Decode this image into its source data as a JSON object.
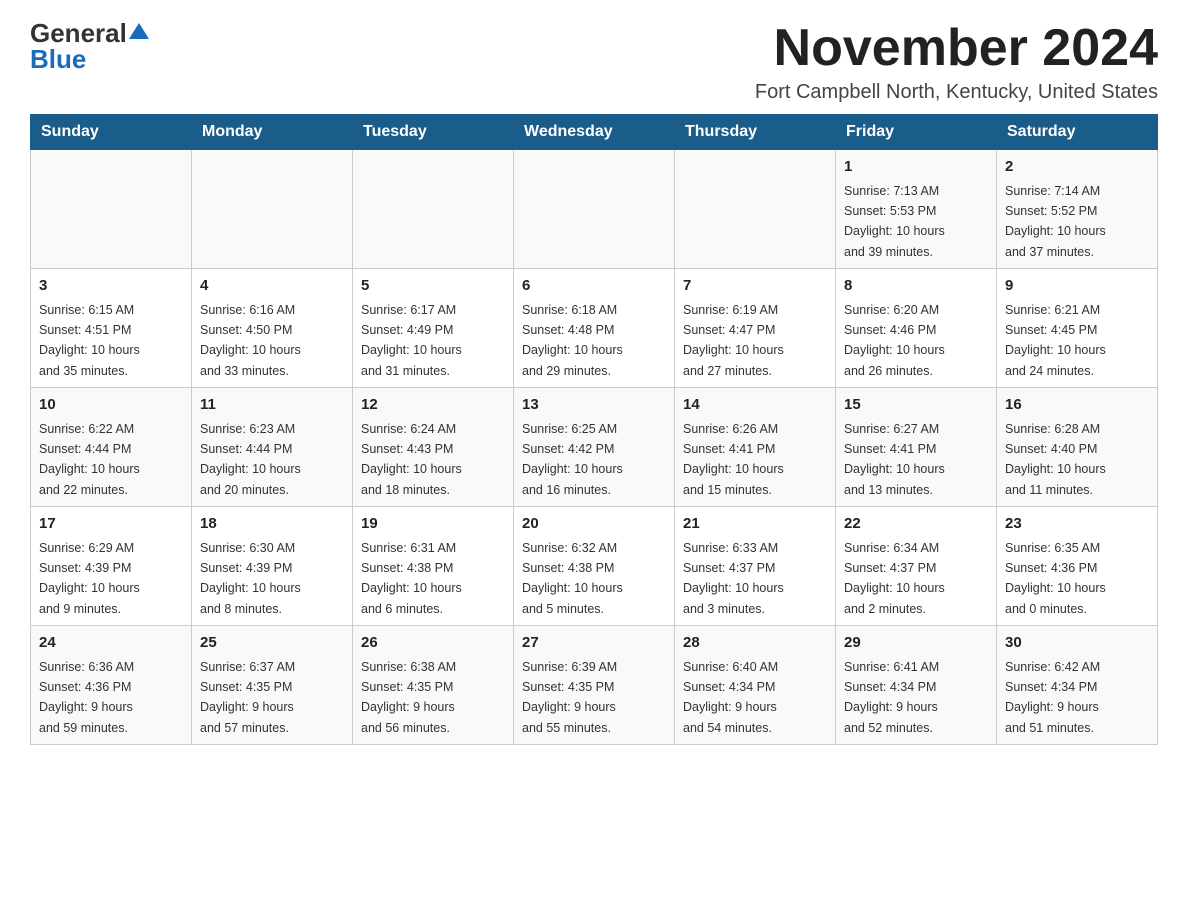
{
  "header": {
    "logo_general": "General",
    "logo_blue": "Blue",
    "month_title": "November 2024",
    "location": "Fort Campbell North, Kentucky, United States"
  },
  "weekdays": [
    "Sunday",
    "Monday",
    "Tuesday",
    "Wednesday",
    "Thursday",
    "Friday",
    "Saturday"
  ],
  "weeks": [
    [
      {
        "day": "",
        "info": ""
      },
      {
        "day": "",
        "info": ""
      },
      {
        "day": "",
        "info": ""
      },
      {
        "day": "",
        "info": ""
      },
      {
        "day": "",
        "info": ""
      },
      {
        "day": "1",
        "info": "Sunrise: 7:13 AM\nSunset: 5:53 PM\nDaylight: 10 hours\nand 39 minutes."
      },
      {
        "day": "2",
        "info": "Sunrise: 7:14 AM\nSunset: 5:52 PM\nDaylight: 10 hours\nand 37 minutes."
      }
    ],
    [
      {
        "day": "3",
        "info": "Sunrise: 6:15 AM\nSunset: 4:51 PM\nDaylight: 10 hours\nand 35 minutes."
      },
      {
        "day": "4",
        "info": "Sunrise: 6:16 AM\nSunset: 4:50 PM\nDaylight: 10 hours\nand 33 minutes."
      },
      {
        "day": "5",
        "info": "Sunrise: 6:17 AM\nSunset: 4:49 PM\nDaylight: 10 hours\nand 31 minutes."
      },
      {
        "day": "6",
        "info": "Sunrise: 6:18 AM\nSunset: 4:48 PM\nDaylight: 10 hours\nand 29 minutes."
      },
      {
        "day": "7",
        "info": "Sunrise: 6:19 AM\nSunset: 4:47 PM\nDaylight: 10 hours\nand 27 minutes."
      },
      {
        "day": "8",
        "info": "Sunrise: 6:20 AM\nSunset: 4:46 PM\nDaylight: 10 hours\nand 26 minutes."
      },
      {
        "day": "9",
        "info": "Sunrise: 6:21 AM\nSunset: 4:45 PM\nDaylight: 10 hours\nand 24 minutes."
      }
    ],
    [
      {
        "day": "10",
        "info": "Sunrise: 6:22 AM\nSunset: 4:44 PM\nDaylight: 10 hours\nand 22 minutes."
      },
      {
        "day": "11",
        "info": "Sunrise: 6:23 AM\nSunset: 4:44 PM\nDaylight: 10 hours\nand 20 minutes."
      },
      {
        "day": "12",
        "info": "Sunrise: 6:24 AM\nSunset: 4:43 PM\nDaylight: 10 hours\nand 18 minutes."
      },
      {
        "day": "13",
        "info": "Sunrise: 6:25 AM\nSunset: 4:42 PM\nDaylight: 10 hours\nand 16 minutes."
      },
      {
        "day": "14",
        "info": "Sunrise: 6:26 AM\nSunset: 4:41 PM\nDaylight: 10 hours\nand 15 minutes."
      },
      {
        "day": "15",
        "info": "Sunrise: 6:27 AM\nSunset: 4:41 PM\nDaylight: 10 hours\nand 13 minutes."
      },
      {
        "day": "16",
        "info": "Sunrise: 6:28 AM\nSunset: 4:40 PM\nDaylight: 10 hours\nand 11 minutes."
      }
    ],
    [
      {
        "day": "17",
        "info": "Sunrise: 6:29 AM\nSunset: 4:39 PM\nDaylight: 10 hours\nand 9 minutes."
      },
      {
        "day": "18",
        "info": "Sunrise: 6:30 AM\nSunset: 4:39 PM\nDaylight: 10 hours\nand 8 minutes."
      },
      {
        "day": "19",
        "info": "Sunrise: 6:31 AM\nSunset: 4:38 PM\nDaylight: 10 hours\nand 6 minutes."
      },
      {
        "day": "20",
        "info": "Sunrise: 6:32 AM\nSunset: 4:38 PM\nDaylight: 10 hours\nand 5 minutes."
      },
      {
        "day": "21",
        "info": "Sunrise: 6:33 AM\nSunset: 4:37 PM\nDaylight: 10 hours\nand 3 minutes."
      },
      {
        "day": "22",
        "info": "Sunrise: 6:34 AM\nSunset: 4:37 PM\nDaylight: 10 hours\nand 2 minutes."
      },
      {
        "day": "23",
        "info": "Sunrise: 6:35 AM\nSunset: 4:36 PM\nDaylight: 10 hours\nand 0 minutes."
      }
    ],
    [
      {
        "day": "24",
        "info": "Sunrise: 6:36 AM\nSunset: 4:36 PM\nDaylight: 9 hours\nand 59 minutes."
      },
      {
        "day": "25",
        "info": "Sunrise: 6:37 AM\nSunset: 4:35 PM\nDaylight: 9 hours\nand 57 minutes."
      },
      {
        "day": "26",
        "info": "Sunrise: 6:38 AM\nSunset: 4:35 PM\nDaylight: 9 hours\nand 56 minutes."
      },
      {
        "day": "27",
        "info": "Sunrise: 6:39 AM\nSunset: 4:35 PM\nDaylight: 9 hours\nand 55 minutes."
      },
      {
        "day": "28",
        "info": "Sunrise: 6:40 AM\nSunset: 4:34 PM\nDaylight: 9 hours\nand 54 minutes."
      },
      {
        "day": "29",
        "info": "Sunrise: 6:41 AM\nSunset: 4:34 PM\nDaylight: 9 hours\nand 52 minutes."
      },
      {
        "day": "30",
        "info": "Sunrise: 6:42 AM\nSunset: 4:34 PM\nDaylight: 9 hours\nand 51 minutes."
      }
    ]
  ]
}
